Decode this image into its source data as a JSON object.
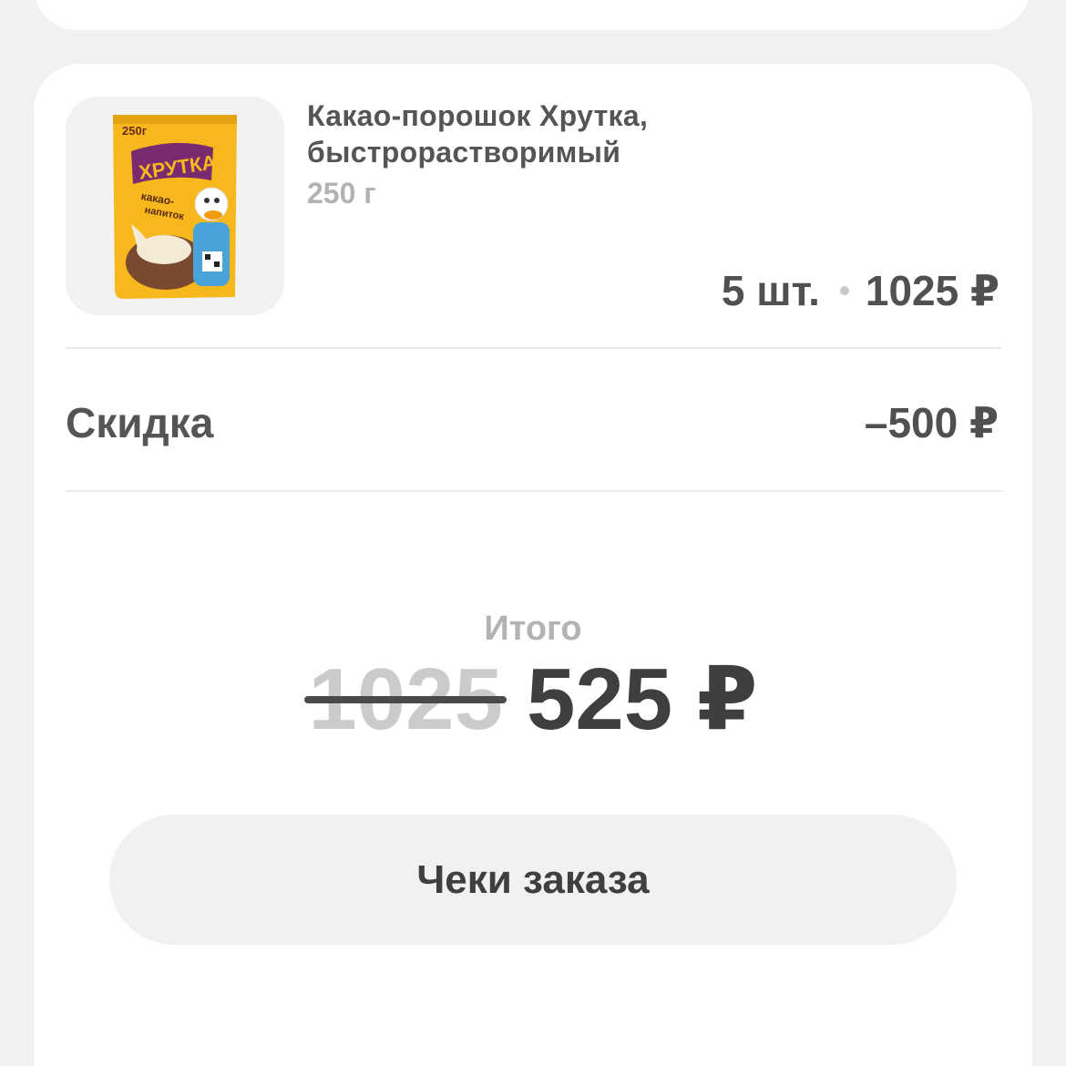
{
  "product": {
    "image_icon": "cocoa-package-icon",
    "name": "Какао-порошок Хрутка, быстрорастворимый",
    "weight": "250 г",
    "quantity": "5 шт.",
    "price": "1025 ₽",
    "package_labels": {
      "weight": "250г",
      "brand": "ХРУТКА",
      "kind_line1": "какао-",
      "kind_line2": "напиток"
    }
  },
  "discount": {
    "label": "Скидка",
    "value": "–500 ₽"
  },
  "total": {
    "label": "Итого",
    "old_amount": "1025",
    "new_amount": "525 ₽"
  },
  "receipts_button": {
    "label": "Чеки заказа"
  },
  "colors": {
    "background": "#f1f1f1",
    "card": "#ffffff",
    "text_primary": "#4a4a4a",
    "text_muted": "#b3b3b3",
    "package_yellow": "#f6b81d",
    "package_brand": "#7a2a6e"
  }
}
